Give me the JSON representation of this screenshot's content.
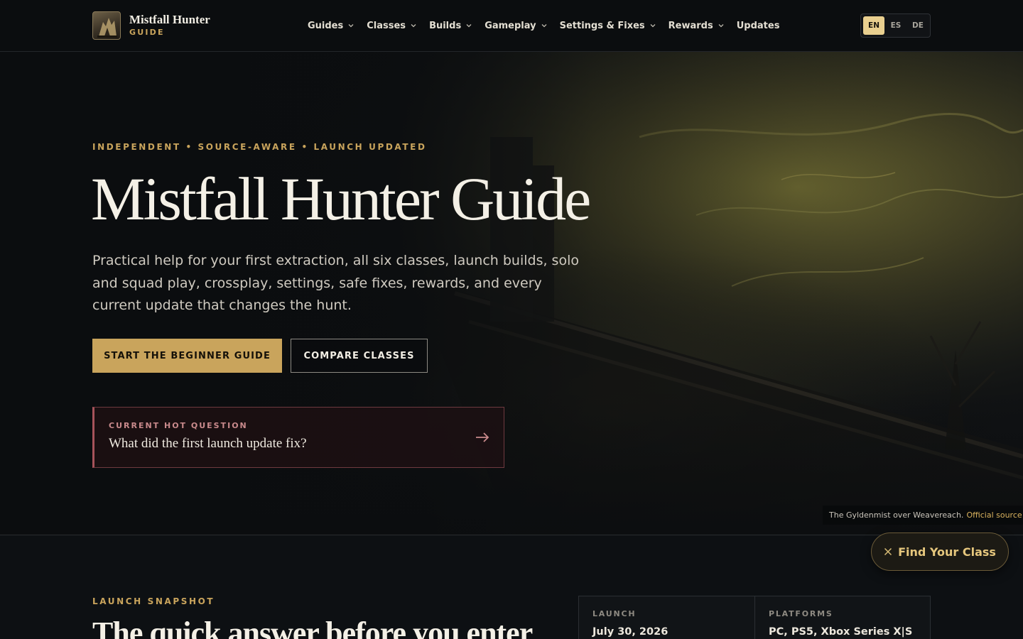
{
  "brand": {
    "title": "Mistfall Hunter",
    "subtitle": "GUIDE",
    "logo_icon": "game-emblem"
  },
  "nav": {
    "items": [
      {
        "label": "Guides",
        "has_dropdown": true
      },
      {
        "label": "Classes",
        "has_dropdown": true
      },
      {
        "label": "Builds",
        "has_dropdown": true
      },
      {
        "label": "Gameplay",
        "has_dropdown": true
      },
      {
        "label": "Settings & Fixes",
        "has_dropdown": true
      },
      {
        "label": "Rewards",
        "has_dropdown": true
      },
      {
        "label": "Updates",
        "has_dropdown": false
      }
    ]
  },
  "language": {
    "options": [
      "EN",
      "ES",
      "DE"
    ],
    "selected": "EN"
  },
  "hero": {
    "eyebrow": "INDEPENDENT • SOURCE-AWARE • LAUNCH UPDATED",
    "title": "Mistfall Hunter Guide",
    "description": "Practical help for your first extraction, all six classes, launch builds, solo and squad play, crossplay, settings, safe fixes, rewards, and every current update that changes the hunt.",
    "primary_cta": "START THE BEGINNER GUIDE",
    "secondary_cta": "COMPARE CLASSES",
    "hot_question": {
      "label": "CURRENT HOT QUESTION",
      "question": "What did the first launch update fix?",
      "arrow_icon": "arrow-right-icon"
    },
    "image_caption": {
      "text": "The Gyldenmist over Weavereach.",
      "link": "Official source"
    }
  },
  "snapshot": {
    "eyebrow": "LAUNCH SNAPSHOT",
    "title": "The quick answer before you enter",
    "facts": [
      {
        "label": "LAUNCH",
        "value": "July 30, 2026"
      },
      {
        "label": "PLATFORMS",
        "value": "PC, PS5, Xbox Series X|S"
      }
    ]
  },
  "floating_button": {
    "label": "Find Your Class",
    "icon": "close-x-icon"
  },
  "colors": {
    "accent_gold": "#c9a45c",
    "hot_question_accent": "#a6525a",
    "background": "#0c0e10"
  }
}
